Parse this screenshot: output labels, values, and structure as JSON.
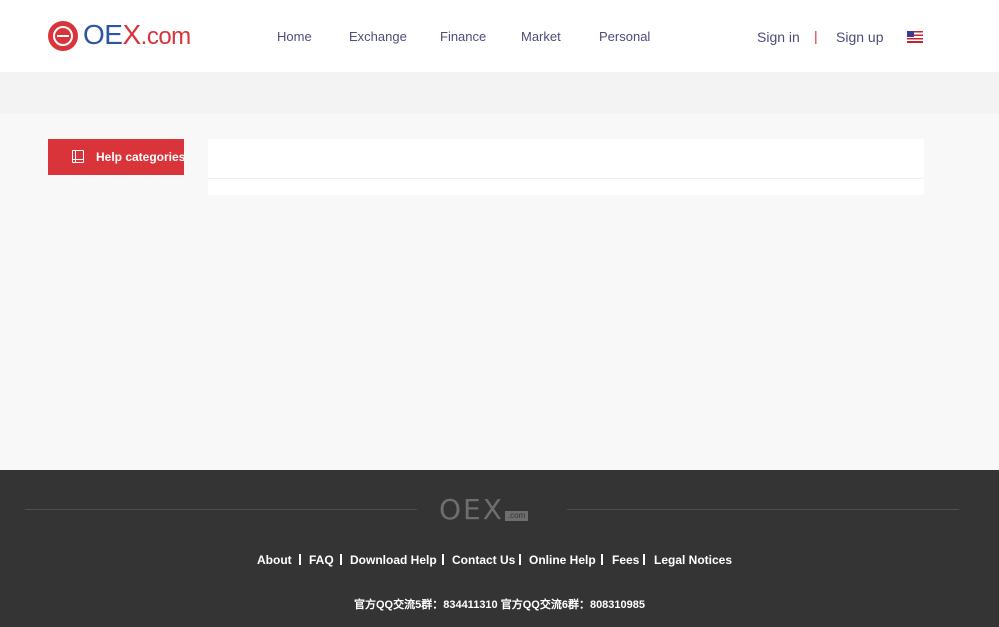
{
  "header": {
    "logo": {
      "main": "OE",
      "x": "X",
      "suffix": ".com"
    },
    "nav": [
      "Home",
      "Exchange",
      "Finance",
      "Market",
      "Personal"
    ],
    "sign_in": "Sign in",
    "separator": "|",
    "sign_up": "Sign up",
    "language_icon": "us-flag-icon"
  },
  "sidebar": {
    "help_categories_label": "Help categories",
    "icon": "book-icon"
  },
  "footer": {
    "logo": {
      "main": "OEX",
      "badge": ".com"
    },
    "links": [
      "About",
      "FAQ",
      "Download Help",
      "Contact Us",
      "Online Help",
      "Fees",
      "Legal Notices"
    ],
    "qq_text": "官方QQ交流5群：834411310 官方QQ交流6群：808310985"
  },
  "colors": {
    "brand_red": "#d9343a",
    "brand_blue": "#2e55a5",
    "nav_text": "#4d4d7a",
    "footer_bg": "#343434"
  }
}
